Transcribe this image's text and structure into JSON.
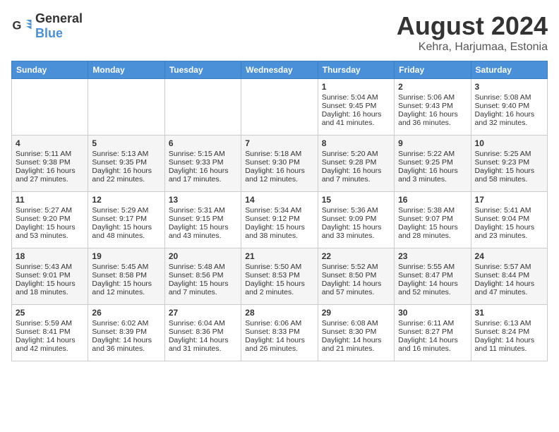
{
  "header": {
    "logo_general": "General",
    "logo_blue": "Blue",
    "month_year": "August 2024",
    "location": "Kehra, Harjumaa, Estonia"
  },
  "calendar": {
    "days_of_week": [
      "Sunday",
      "Monday",
      "Tuesday",
      "Wednesday",
      "Thursday",
      "Friday",
      "Saturday"
    ],
    "weeks": [
      [
        {
          "day": "",
          "content": ""
        },
        {
          "day": "",
          "content": ""
        },
        {
          "day": "",
          "content": ""
        },
        {
          "day": "",
          "content": ""
        },
        {
          "day": "1",
          "content": "Sunrise: 5:04 AM\nSunset: 9:45 PM\nDaylight: 16 hours\nand 41 minutes."
        },
        {
          "day": "2",
          "content": "Sunrise: 5:06 AM\nSunset: 9:43 PM\nDaylight: 16 hours\nand 36 minutes."
        },
        {
          "day": "3",
          "content": "Sunrise: 5:08 AM\nSunset: 9:40 PM\nDaylight: 16 hours\nand 32 minutes."
        }
      ],
      [
        {
          "day": "4",
          "content": "Sunrise: 5:11 AM\nSunset: 9:38 PM\nDaylight: 16 hours\nand 27 minutes."
        },
        {
          "day": "5",
          "content": "Sunrise: 5:13 AM\nSunset: 9:35 PM\nDaylight: 16 hours\nand 22 minutes."
        },
        {
          "day": "6",
          "content": "Sunrise: 5:15 AM\nSunset: 9:33 PM\nDaylight: 16 hours\nand 17 minutes."
        },
        {
          "day": "7",
          "content": "Sunrise: 5:18 AM\nSunset: 9:30 PM\nDaylight: 16 hours\nand 12 minutes."
        },
        {
          "day": "8",
          "content": "Sunrise: 5:20 AM\nSunset: 9:28 PM\nDaylight: 16 hours\nand 7 minutes."
        },
        {
          "day": "9",
          "content": "Sunrise: 5:22 AM\nSunset: 9:25 PM\nDaylight: 16 hours\nand 3 minutes."
        },
        {
          "day": "10",
          "content": "Sunrise: 5:25 AM\nSunset: 9:23 PM\nDaylight: 15 hours\nand 58 minutes."
        }
      ],
      [
        {
          "day": "11",
          "content": "Sunrise: 5:27 AM\nSunset: 9:20 PM\nDaylight: 15 hours\nand 53 minutes."
        },
        {
          "day": "12",
          "content": "Sunrise: 5:29 AM\nSunset: 9:17 PM\nDaylight: 15 hours\nand 48 minutes."
        },
        {
          "day": "13",
          "content": "Sunrise: 5:31 AM\nSunset: 9:15 PM\nDaylight: 15 hours\nand 43 minutes."
        },
        {
          "day": "14",
          "content": "Sunrise: 5:34 AM\nSunset: 9:12 PM\nDaylight: 15 hours\nand 38 minutes."
        },
        {
          "day": "15",
          "content": "Sunrise: 5:36 AM\nSunset: 9:09 PM\nDaylight: 15 hours\nand 33 minutes."
        },
        {
          "day": "16",
          "content": "Sunrise: 5:38 AM\nSunset: 9:07 PM\nDaylight: 15 hours\nand 28 minutes."
        },
        {
          "day": "17",
          "content": "Sunrise: 5:41 AM\nSunset: 9:04 PM\nDaylight: 15 hours\nand 23 minutes."
        }
      ],
      [
        {
          "day": "18",
          "content": "Sunrise: 5:43 AM\nSunset: 9:01 PM\nDaylight: 15 hours\nand 18 minutes."
        },
        {
          "day": "19",
          "content": "Sunrise: 5:45 AM\nSunset: 8:58 PM\nDaylight: 15 hours\nand 12 minutes."
        },
        {
          "day": "20",
          "content": "Sunrise: 5:48 AM\nSunset: 8:56 PM\nDaylight: 15 hours\nand 7 minutes."
        },
        {
          "day": "21",
          "content": "Sunrise: 5:50 AM\nSunset: 8:53 PM\nDaylight: 15 hours\nand 2 minutes."
        },
        {
          "day": "22",
          "content": "Sunrise: 5:52 AM\nSunset: 8:50 PM\nDaylight: 14 hours\nand 57 minutes."
        },
        {
          "day": "23",
          "content": "Sunrise: 5:55 AM\nSunset: 8:47 PM\nDaylight: 14 hours\nand 52 minutes."
        },
        {
          "day": "24",
          "content": "Sunrise: 5:57 AM\nSunset: 8:44 PM\nDaylight: 14 hours\nand 47 minutes."
        }
      ],
      [
        {
          "day": "25",
          "content": "Sunrise: 5:59 AM\nSunset: 8:41 PM\nDaylight: 14 hours\nand 42 minutes."
        },
        {
          "day": "26",
          "content": "Sunrise: 6:02 AM\nSunset: 8:39 PM\nDaylight: 14 hours\nand 36 minutes."
        },
        {
          "day": "27",
          "content": "Sunrise: 6:04 AM\nSunset: 8:36 PM\nDaylight: 14 hours\nand 31 minutes."
        },
        {
          "day": "28",
          "content": "Sunrise: 6:06 AM\nSunset: 8:33 PM\nDaylight: 14 hours\nand 26 minutes."
        },
        {
          "day": "29",
          "content": "Sunrise: 6:08 AM\nSunset: 8:30 PM\nDaylight: 14 hours\nand 21 minutes."
        },
        {
          "day": "30",
          "content": "Sunrise: 6:11 AM\nSunset: 8:27 PM\nDaylight: 14 hours\nand 16 minutes."
        },
        {
          "day": "31",
          "content": "Sunrise: 6:13 AM\nSunset: 8:24 PM\nDaylight: 14 hours\nand 11 minutes."
        }
      ]
    ]
  }
}
